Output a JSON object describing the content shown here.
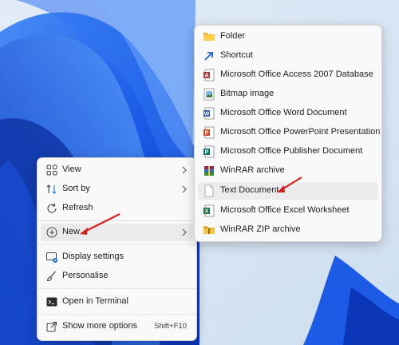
{
  "context_menu": {
    "items": [
      {
        "label": "View",
        "icon": "grid-view-icon"
      },
      {
        "label": "Sort by",
        "icon": "sort-icon"
      },
      {
        "label": "Refresh",
        "icon": "refresh-icon"
      },
      {
        "label": "New",
        "icon": "new-plus-icon"
      },
      {
        "label": "Display settings",
        "icon": "display-icon"
      },
      {
        "label": "Personalise",
        "icon": "brush-icon"
      },
      {
        "label": "Open in Terminal",
        "icon": "terminal-icon"
      },
      {
        "label": "Show more options",
        "icon": "share-icon",
        "shortcut": "Shift+F10"
      }
    ]
  },
  "new_submenu": {
    "items": [
      {
        "label": "Folder",
        "icon": "folder-icon"
      },
      {
        "label": "Shortcut",
        "icon": "shortcut-icon"
      },
      {
        "label": "Microsoft Office Access 2007 Database",
        "icon": "access-icon"
      },
      {
        "label": "Bitmap image",
        "icon": "bitmap-icon"
      },
      {
        "label": "Microsoft Office Word Document",
        "icon": "word-icon"
      },
      {
        "label": "Microsoft Office PowerPoint Presentation",
        "icon": "powerpoint-icon"
      },
      {
        "label": "Microsoft Office Publisher Document",
        "icon": "publisher-icon"
      },
      {
        "label": "WinRAR archive",
        "icon": "winrar-icon"
      },
      {
        "label": "Text Document",
        "icon": "text-document-icon"
      },
      {
        "label": "Microsoft Office Excel Worksheet",
        "icon": "excel-icon"
      },
      {
        "label": "WinRAR ZIP archive",
        "icon": "zip-folder-icon"
      }
    ]
  },
  "colors": {
    "accent": "#0b57d0",
    "arrow": "#d21f1f",
    "menu_bg": "#f9f9f9"
  }
}
